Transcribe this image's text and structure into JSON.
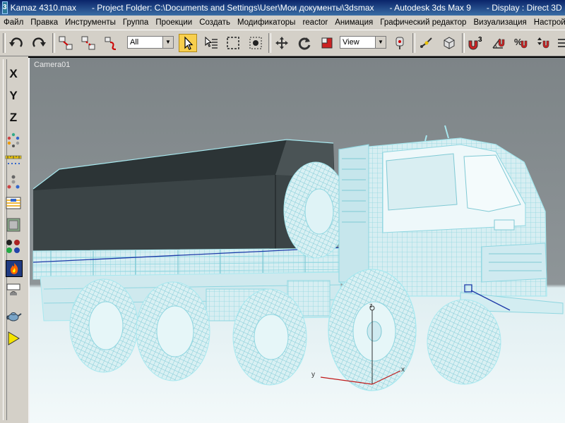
{
  "window": {
    "file": "Kamaz 4310.max",
    "project": "- Project Folder: C:\\Documents and Settings\\User\\Мои документы\\3dsmax",
    "app": "- Autodesk 3ds Max 9",
    "display": "- Display : Direct 3D"
  },
  "menu": [
    "Файл",
    "Правка",
    "Инструменты",
    "Группа",
    "Проекции",
    "Создать",
    "Модификаторы",
    "reactor",
    "Анимация",
    "Графический редактор",
    "Визуализация",
    "Настройка"
  ],
  "toolbar": {
    "selection_filter": "All",
    "reference_coord": "View",
    "snap_label": "3"
  },
  "left_toolbar": {
    "x_label": "X",
    "y_label": "Y",
    "z_label": "Z"
  },
  "viewport": {
    "label": "Camera01",
    "gizmo_y": "y",
    "gizmo_x": "x",
    "gizmo_z": "z"
  },
  "colors": {
    "viewport_bg_top": "#7d8487",
    "viewport_floor": "#e4eff2",
    "wire": "#a8e8ef",
    "tarp": "#3d4547",
    "active_tool": "#f8cf4d"
  }
}
